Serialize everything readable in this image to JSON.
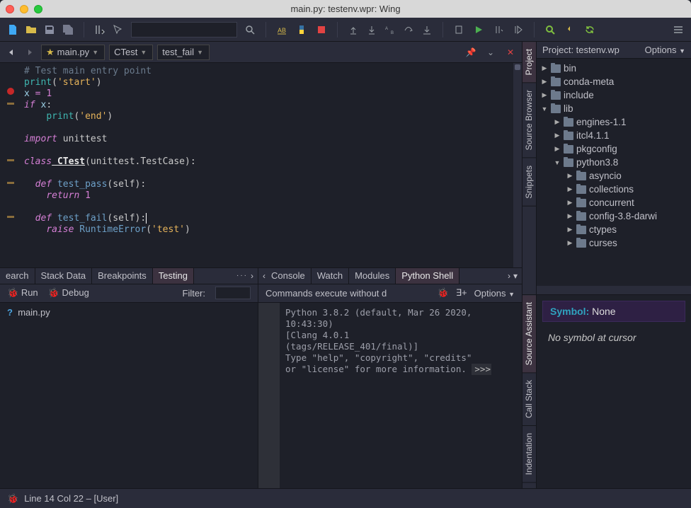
{
  "window": {
    "title": "main.py: testenv.wpr: Wing"
  },
  "toolbar": {
    "search_placeholder": ""
  },
  "editor": {
    "file_tab": "main.py",
    "class_dropdown": "CTest",
    "method_dropdown": "test_fail",
    "code": {
      "l1": "# Test main entry point",
      "l2a": "print",
      "l2b": "(",
      "l2c": "'start'",
      "l2d": ")",
      "l3a": "x",
      "l3b": " = ",
      "l3c": "1",
      "l4a": "if",
      "l4b": " x",
      "l4c": ":",
      "l5a": "    ",
      "l5b": "print",
      "l5c": "(",
      "l5d": "'end'",
      "l5e": ")",
      "l6": "",
      "l7a": "import",
      "l7b": " unittest",
      "l8": "",
      "l9a": "class",
      "l9b": " CTest",
      "l9c": "(unittest.TestCase)",
      "l9d": ":",
      "l10": "",
      "l11a": "  ",
      "l11b": "def",
      "l11c": " test_pass",
      "l11d": "(self)",
      "l11e": ":",
      "l12a": "    ",
      "l12b": "return",
      "l12c": " 1",
      "l13": "",
      "l14a": "  ",
      "l14b": "def",
      "l14c": " test_fail",
      "l14d": "(self)",
      "l14e": ":",
      "l15a": "    ",
      "l15b": "raise",
      "l15c": " RuntimeError",
      "l15d": "(",
      "l15e": "'test'",
      "l15f": ")"
    }
  },
  "bottom_left": {
    "tabs": [
      "earch",
      "Stack Data",
      "Breakpoints",
      "Testing"
    ],
    "run": "Run",
    "debug": "Debug",
    "filter_label": "Filter:",
    "item": "main.py"
  },
  "bottom_right": {
    "tabs": [
      "Console",
      "Watch",
      "Modules",
      "Python Shell"
    ],
    "banner": "Commands execute without d",
    "options": "Options",
    "shell": "Python 3.8.2 (default, Mar 26 2020,\n10:43:30)\n[Clang 4.0.1\n(tags/RELEASE_401/final)]\nType \"help\", \"copyright\", \"credits\"\nor \"license\" for more information.",
    "prompt": ">>>"
  },
  "project": {
    "title": "Project: testenv.wp",
    "options": "Options",
    "tree": [
      {
        "depth": 0,
        "exp": false,
        "label": "bin"
      },
      {
        "depth": 0,
        "exp": false,
        "label": "conda-meta"
      },
      {
        "depth": 0,
        "exp": false,
        "label": "include"
      },
      {
        "depth": 0,
        "exp": true,
        "label": "lib"
      },
      {
        "depth": 1,
        "exp": false,
        "label": "engines-1.1"
      },
      {
        "depth": 1,
        "exp": false,
        "label": "itcl4.1.1"
      },
      {
        "depth": 1,
        "exp": false,
        "label": "pkgconfig"
      },
      {
        "depth": 1,
        "exp": true,
        "label": "python3.8"
      },
      {
        "depth": 2,
        "exp": false,
        "label": "asyncio"
      },
      {
        "depth": 2,
        "exp": false,
        "label": "collections"
      },
      {
        "depth": 2,
        "exp": false,
        "label": "concurrent"
      },
      {
        "depth": 2,
        "exp": false,
        "label": "config-3.8-darwi"
      },
      {
        "depth": 2,
        "exp": false,
        "label": "ctypes"
      },
      {
        "depth": 2,
        "exp": false,
        "label": "curses"
      }
    ]
  },
  "source_assistant": {
    "symbol_label": "Symbol:",
    "symbol_value": "None",
    "message": "No symbol at cursor"
  },
  "side_tabs_upper": [
    "Project",
    "Source Browser",
    "Snippets"
  ],
  "side_tabs_lower": [
    "Source Assistant",
    "Call Stack",
    "Indentation"
  ],
  "statusbar": {
    "text": "Line 14 Col 22 – [User]"
  }
}
